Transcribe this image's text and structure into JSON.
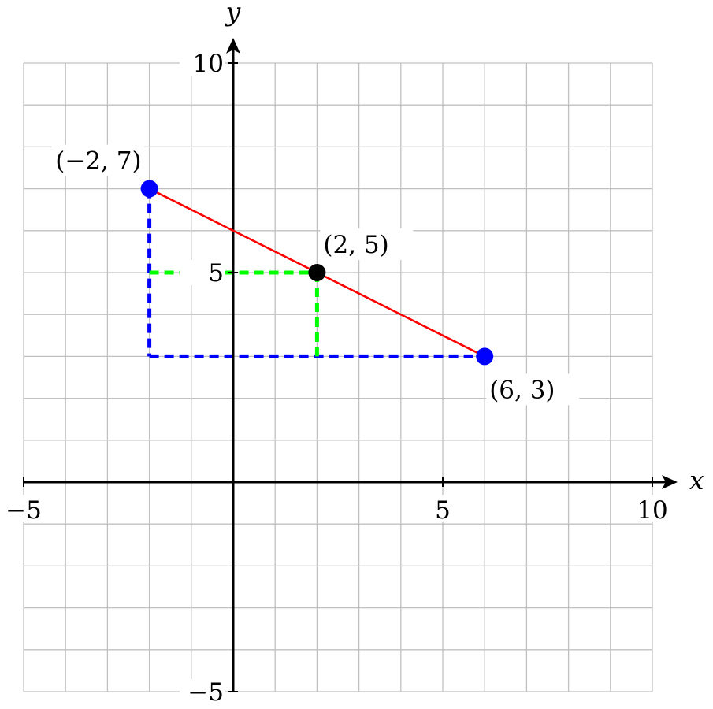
{
  "chart_data": {
    "type": "scatter",
    "title": "",
    "xlabel": "x",
    "ylabel": "y",
    "xlim": [
      -5,
      10
    ],
    "ylim": [
      -5,
      10
    ],
    "grid": true,
    "grid_step": 1,
    "x_ticks": [
      {
        "value": -5,
        "label": "−5"
      },
      {
        "value": 5,
        "label": "5"
      },
      {
        "value": 10,
        "label": "10"
      }
    ],
    "y_ticks": [
      {
        "value": -5,
        "label": "−5"
      },
      {
        "value": 5,
        "label": "5"
      },
      {
        "value": 10,
        "label": "10"
      }
    ],
    "points": [
      {
        "x": -2,
        "y": 7,
        "label": "(−2, 7)",
        "color": "#0000ff",
        "label_pos": "upper-left"
      },
      {
        "x": 6,
        "y": 3,
        "label": "(6, 3)",
        "color": "#0000ff",
        "label_pos": "lower-right"
      },
      {
        "x": 2,
        "y": 5,
        "label": "(2, 5)",
        "color": "#000000",
        "label_pos": "upper-right"
      }
    ],
    "segments": [
      {
        "from": [
          -2,
          7
        ],
        "to": [
          6,
          3
        ],
        "color": "#ff0000",
        "style": "solid"
      }
    ],
    "guides": [
      {
        "from": [
          -2,
          7
        ],
        "to": [
          -2,
          3
        ],
        "color": "#0000ff",
        "style": "dashed"
      },
      {
        "from": [
          -2,
          3
        ],
        "to": [
          6,
          3
        ],
        "color": "#0000ff",
        "style": "dashed"
      },
      {
        "from": [
          -2,
          5
        ],
        "to": [
          2,
          5
        ],
        "color": "#00ff00",
        "style": "dashed"
      },
      {
        "from": [
          2,
          5
        ],
        "to": [
          2,
          3
        ],
        "color": "#00ff00",
        "style": "dashed"
      }
    ]
  }
}
